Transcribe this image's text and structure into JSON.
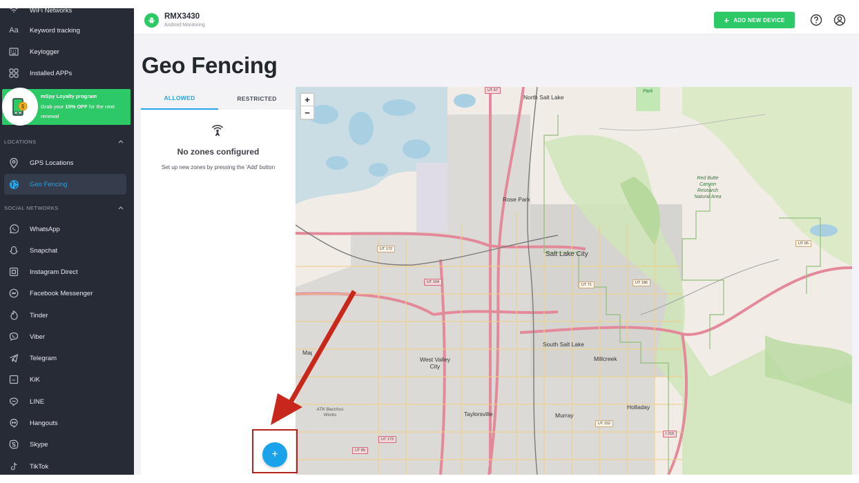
{
  "sidebar": {
    "top_items": [
      {
        "label": "WiFi Networks",
        "icon": "wifi-icon"
      },
      {
        "label": "Keyword tracking",
        "icon": "keyword-icon"
      },
      {
        "label": "Keylogger",
        "icon": "keyboard-icon"
      },
      {
        "label": "Installed APPs",
        "icon": "apps-grid-icon"
      }
    ],
    "promo": {
      "title": "mSpy Loyalty program",
      "text_prefix": "Grab your ",
      "text_bold": "15% OFF",
      "text_suffix": " for the next renewal",
      "icon": "phone-coin-icon"
    },
    "sections": [
      {
        "title": "LOCATIONS",
        "items": [
          {
            "label": "GPS Locations",
            "icon": "map-pin-icon",
            "active": false
          },
          {
            "label": "Geo Fencing",
            "icon": "globe-icon",
            "active": true
          }
        ]
      },
      {
        "title": "SOCIAL NETWORKS",
        "items": [
          {
            "label": "WhatsApp",
            "icon": "whatsapp-icon"
          },
          {
            "label": "Snapchat",
            "icon": "snapchat-icon"
          },
          {
            "label": "Instagram Direct",
            "icon": "instagram-icon"
          },
          {
            "label": "Facebook Messenger",
            "icon": "messenger-icon"
          },
          {
            "label": "Tinder",
            "icon": "tinder-icon"
          },
          {
            "label": "Viber",
            "icon": "viber-icon"
          },
          {
            "label": "Telegram",
            "icon": "telegram-icon"
          },
          {
            "label": "KiK",
            "icon": "kik-icon"
          },
          {
            "label": "LINE",
            "icon": "line-icon"
          },
          {
            "label": "Hangouts",
            "icon": "hangouts-icon"
          },
          {
            "label": "Skype",
            "icon": "skype-icon"
          },
          {
            "label": "TikTok",
            "icon": "tiktok-icon"
          }
        ]
      }
    ]
  },
  "header": {
    "device_name": "RMX3430",
    "device_subtitle": "Android Monitoring",
    "add_device_label": "ADD NEW DEVICE",
    "help_icon": "help-circle-icon",
    "account_icon": "user-circle-icon"
  },
  "page": {
    "title": "Geo Fencing",
    "tabs": [
      {
        "label": "ALLOWED",
        "active": true
      },
      {
        "label": "RESTRICTED",
        "active": false
      }
    ],
    "empty_state": {
      "icon": "antenna-icon",
      "title": "No zones configured",
      "text": "Set up new zones by pressing the 'Add' button"
    },
    "fab_label": "+"
  },
  "map": {
    "zoom_in": "+",
    "zoom_out": "−",
    "labels": [
      {
        "text": "North Salt Lake"
      },
      {
        "text": "Rose Park"
      },
      {
        "text": "Salt Lake City"
      },
      {
        "text": "South Salt Lake"
      },
      {
        "text": "West Valley City"
      },
      {
        "text": "Millcreek"
      },
      {
        "text": "Taylorsville"
      },
      {
        "text": "Murray"
      },
      {
        "text": "Holladay"
      },
      {
        "text": "Magna"
      },
      {
        "text": "ATK Bacchus Works"
      },
      {
        "text": "Red Butte Canyon Research Natural Area"
      },
      {
        "text": "Park"
      }
    ],
    "shields": [
      "UT 67",
      "UT 172",
      "UT 154",
      "UT 71",
      "UT 186",
      "UT 65",
      "UT 173",
      "UT 85",
      "UT 152",
      "I 215"
    ]
  },
  "annotation": {
    "arrow_color": "#c8281c",
    "box_color": "#b3231c"
  },
  "colors": {
    "brand_green": "#2ec967",
    "accent_blue": "#2aa2e6",
    "sidebar_bg": "#262b36"
  }
}
